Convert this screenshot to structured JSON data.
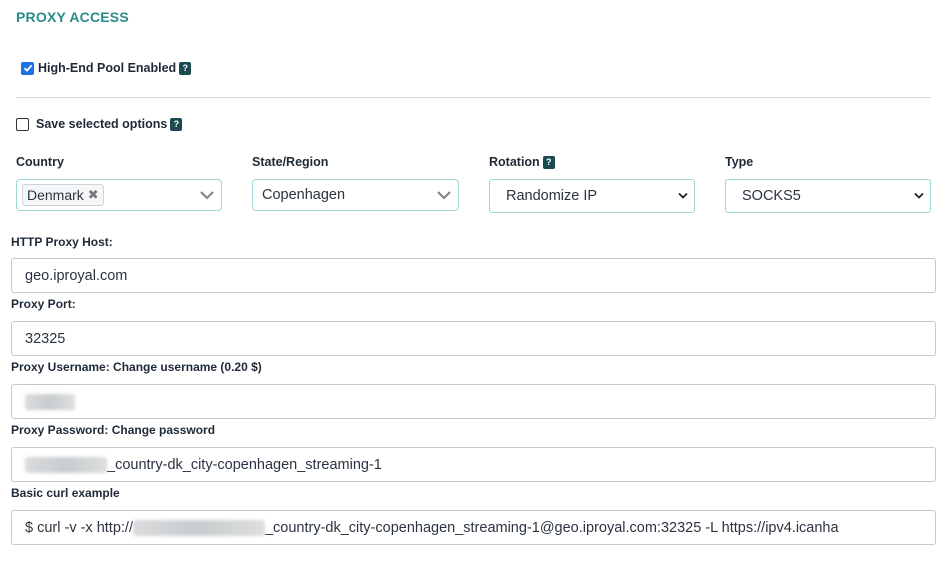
{
  "section": {
    "title": "PROXY ACCESS"
  },
  "high_end_pool": {
    "label": "High-End Pool Enabled",
    "checked": true,
    "help": "?"
  },
  "save_options": {
    "label": "Save selected options",
    "checked": false,
    "help": "?"
  },
  "columns": {
    "country": {
      "label": "Country",
      "selected_chip": "Denmark",
      "remove_glyph": "✖"
    },
    "region": {
      "label": "State/Region",
      "value": "Copenhagen"
    },
    "rotation": {
      "label": "Rotation",
      "help": "?",
      "value": "Randomize IP"
    },
    "type": {
      "label": "Type",
      "value": "SOCKS5"
    }
  },
  "fields": {
    "host": {
      "label": "HTTP Proxy Host:",
      "value": "geo.iproyal.com"
    },
    "port": {
      "label": "Proxy Port:",
      "value": "32325"
    },
    "username": {
      "label": "Proxy Username: Change username (0.20 $)",
      "value": ""
    },
    "password": {
      "label": "Proxy Password: Change password",
      "value_suffix": "_country-dk_city-copenhagen_streaming-1"
    },
    "curl": {
      "label": "Basic curl example",
      "prefix": "$ curl -v -x http://",
      "suffix": "_country-dk_city-copenhagen_streaming-1@geo.iproyal.com:32325 -L https://ipv4.icanha"
    }
  },
  "colors": {
    "accent": "#2a8a8a",
    "help_bg": "#1b4a52",
    "checkbox": "#1a73e8",
    "select_border": "#9fd6d6"
  }
}
